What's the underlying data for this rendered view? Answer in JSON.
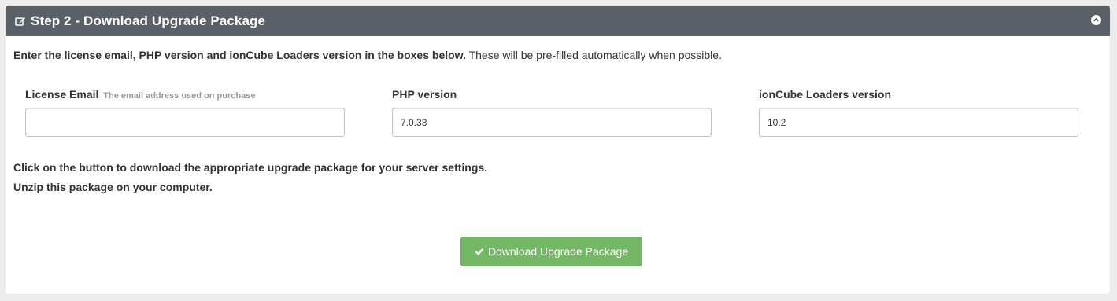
{
  "panel": {
    "title": "Step 2 - Download Upgrade Package",
    "icons": {
      "title": "edit-icon",
      "collapse": "chevron-up-circle-icon"
    },
    "header_color": "#5a6067"
  },
  "intro": {
    "bold": "Enter the license email, PHP version and ionCube Loaders version in the boxes below.",
    "normal": " These will be pre-filled automatically when possible."
  },
  "fields": {
    "email": {
      "label": "License Email",
      "hint": "The email address used on purchase",
      "value": ""
    },
    "php": {
      "label": "PHP version",
      "value": "7.0.33"
    },
    "ioncube": {
      "label": "ionCube Loaders version",
      "value": "10.2"
    }
  },
  "notes": {
    "line1": "Click on the button to download the appropriate upgrade package for your server settings.",
    "line2": "Unzip this package on your computer."
  },
  "button": {
    "label": "Download Upgrade Package",
    "icon": "check-icon",
    "color": "#74b866"
  }
}
